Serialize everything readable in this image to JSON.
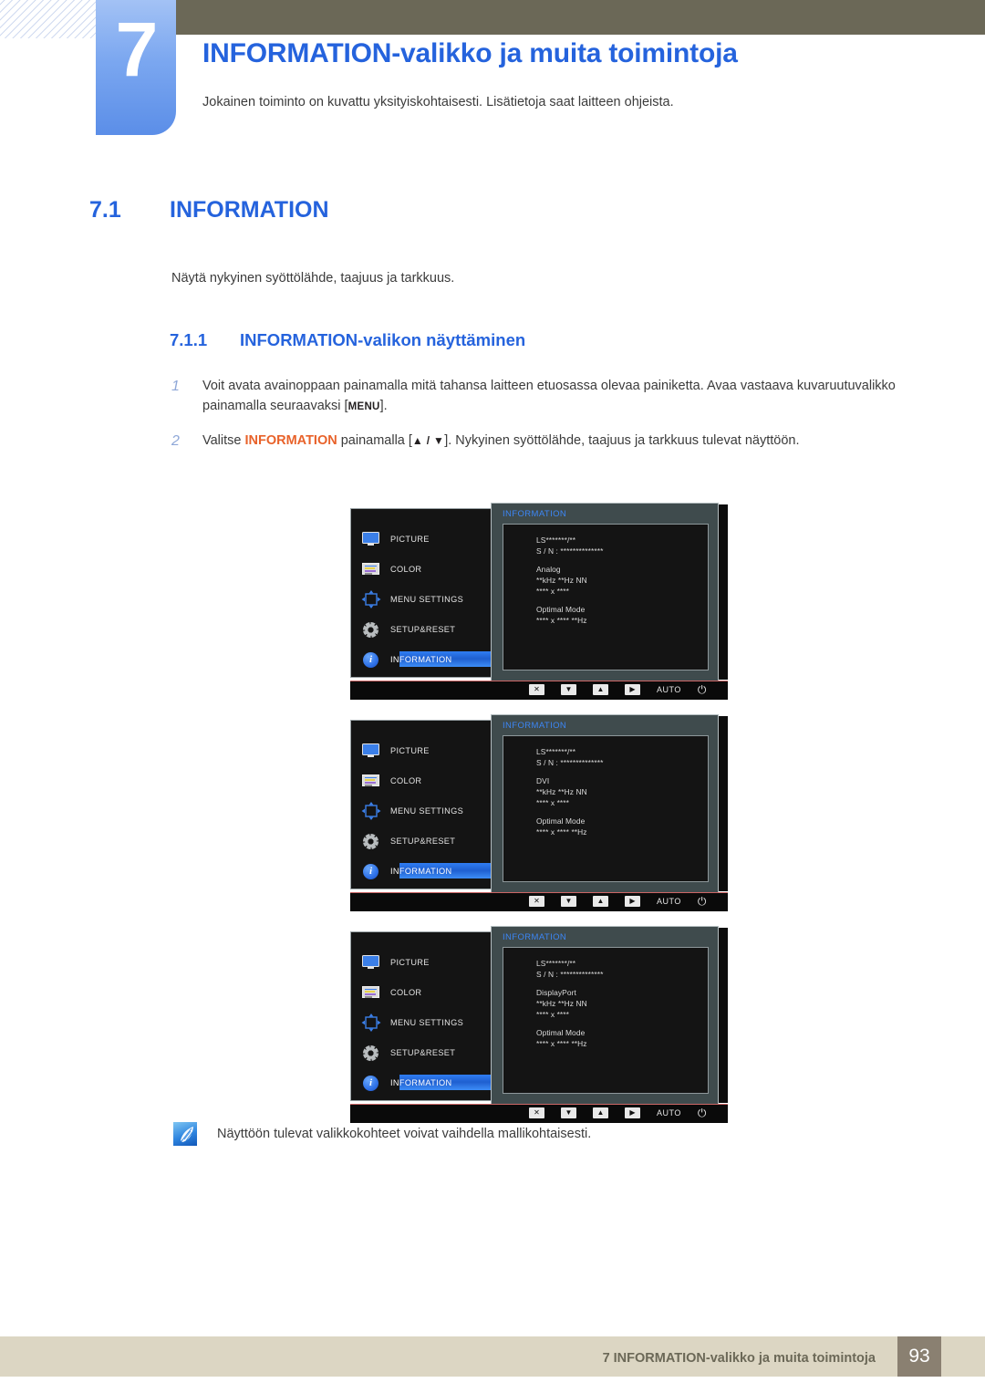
{
  "chapter": {
    "number": "7",
    "title": "INFORMATION-valikko ja muita toimintoja",
    "subtitle": "Jokainen toiminto on kuvattu yksityiskohtaisesti. Lisätietoja saat laitteen ohjeista."
  },
  "section": {
    "number": "7.1",
    "title": "INFORMATION",
    "intro": "Näytä nykyinen syöttölähde, taajuus ja tarkkuus."
  },
  "subsection": {
    "number": "7.1.1",
    "title": "INFORMATION-valikon näyttäminen"
  },
  "steps": [
    {
      "number": "1",
      "part1": "Voit avata avainoppaan painamalla mitä tahansa laitteen etuosassa olevaa painiketta. Avaa vastaava kuvaruutuvalikko painamalla seuraavaksi [",
      "key": "MENU",
      "part2": "]."
    },
    {
      "number": "2",
      "part1": "Valitse ",
      "highlight": "INFORMATION",
      "part2": " painamalla [",
      "key": "▲ / ▼",
      "part3": "]. Nykyinen syöttölähde, taajuus ja tarkkuus tulevat näyttöön."
    }
  ],
  "osd": {
    "menu_items": [
      {
        "label": "PICTURE",
        "icon": "monitor-icon"
      },
      {
        "label": "COLOR",
        "icon": "color-bars-icon"
      },
      {
        "label": "MENU SETTINGS",
        "icon": "four-arrows-icon"
      },
      {
        "label": "SETUP&RESET",
        "icon": "gear-icon"
      },
      {
        "label": "INFORMATION",
        "icon": "info-circle-icon",
        "selected": true
      }
    ],
    "panel_title": "INFORMATION",
    "model_line": "LS*******/**",
    "serial_line": "S / N : **************",
    "freq_line": "**kHz **Hz NN",
    "res_line": "**** x ****",
    "optimal_label": "Optimal Mode",
    "optimal_value": "**** x **** **Hz",
    "buttons": {
      "close": "✕",
      "down": "▼",
      "up": "▲",
      "right": "▶",
      "auto": "AUTO",
      "power": "⏻"
    },
    "screens": [
      {
        "source": "Analog"
      },
      {
        "source": "DVI"
      },
      {
        "source": "DisplayPort"
      }
    ]
  },
  "note": {
    "icon": "quill-note-icon",
    "text": "Näyttöön tulevat valikkokohteet voivat vaihdella mallikohtaisesti."
  },
  "footer": {
    "text": "7 INFORMATION-valikko ja muita toimintoja",
    "page": "93"
  },
  "colors": {
    "accent_blue": "#2563dd",
    "header_olive": "#6b6857",
    "tab_blue": "#7ba7f0",
    "orange": "#e8622a",
    "footer_band": "#dcd6c3",
    "footer_page_box": "#8a8071"
  }
}
